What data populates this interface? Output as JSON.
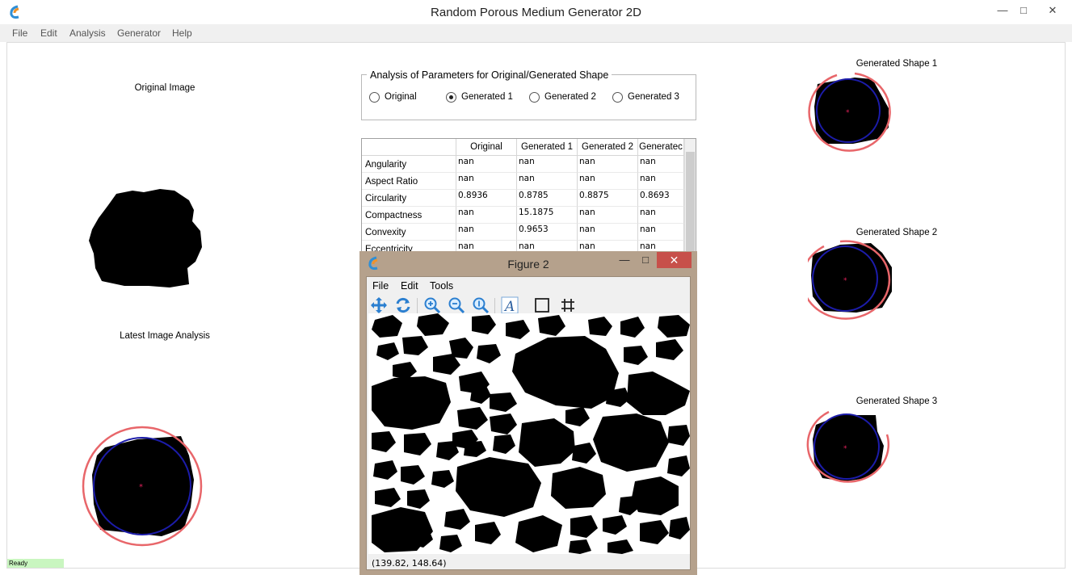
{
  "window": {
    "title": "Random Porous Medium Generator 2D",
    "controls": {
      "minimize": "—",
      "maximize": "□",
      "close": "✕"
    }
  },
  "menu": [
    "File",
    "Edit",
    "Analysis",
    "Generator",
    "Help"
  ],
  "left_panel": {
    "original_caption": "Original Image",
    "analysis_caption": "Latest Image Analysis"
  },
  "analysis": {
    "group_title": "Analysis of Parameters for Original/Generated Shape",
    "options": [
      "Original",
      "Generated 1",
      "Generated 2",
      "Generated 3"
    ],
    "selected": "Generated 1"
  },
  "table": {
    "columns": [
      "Original",
      "Generated 1",
      "Generated 2",
      "Generatec"
    ],
    "rows": [
      {
        "name": "Angularity",
        "values": [
          "nan",
          "nan",
          "nan",
          "nan"
        ]
      },
      {
        "name": "Aspect Ratio",
        "values": [
          "nan",
          "nan",
          "nan",
          "nan"
        ]
      },
      {
        "name": "Circularity",
        "values": [
          "0.8936",
          "0.8785",
          "0.8875",
          "0.8693"
        ]
      },
      {
        "name": "Compactness",
        "values": [
          "nan",
          "15.1875",
          "nan",
          "nan"
        ]
      },
      {
        "name": "Convexity",
        "values": [
          "nan",
          "0.9653",
          "nan",
          "nan"
        ]
      },
      {
        "name": "Eccentricity",
        "values": [
          "nan",
          "nan",
          "nan",
          "nan"
        ]
      }
    ]
  },
  "right_panel": {
    "shape1_caption": "Generated Shape 1",
    "shape2_caption": "Generated Shape 2",
    "shape3_caption": "Generated Shape 3"
  },
  "figure": {
    "title": "Figure 2",
    "menu": [
      "File",
      "Edit",
      "Tools"
    ],
    "coords": "(139.82, 148.64)",
    "toolbar": [
      "pan-icon",
      "reset-view-icon",
      "zoom-in-icon",
      "zoom-out-icon",
      "zoom-reset-icon",
      "text-icon",
      "rectangle-icon",
      "grid-icon"
    ]
  },
  "status": "Ready",
  "colors": {
    "circle_red": "#e8666a",
    "circle_blue": "#1c1caa",
    "center_marker": "#e0205a",
    "close_red": "#c7504a"
  }
}
